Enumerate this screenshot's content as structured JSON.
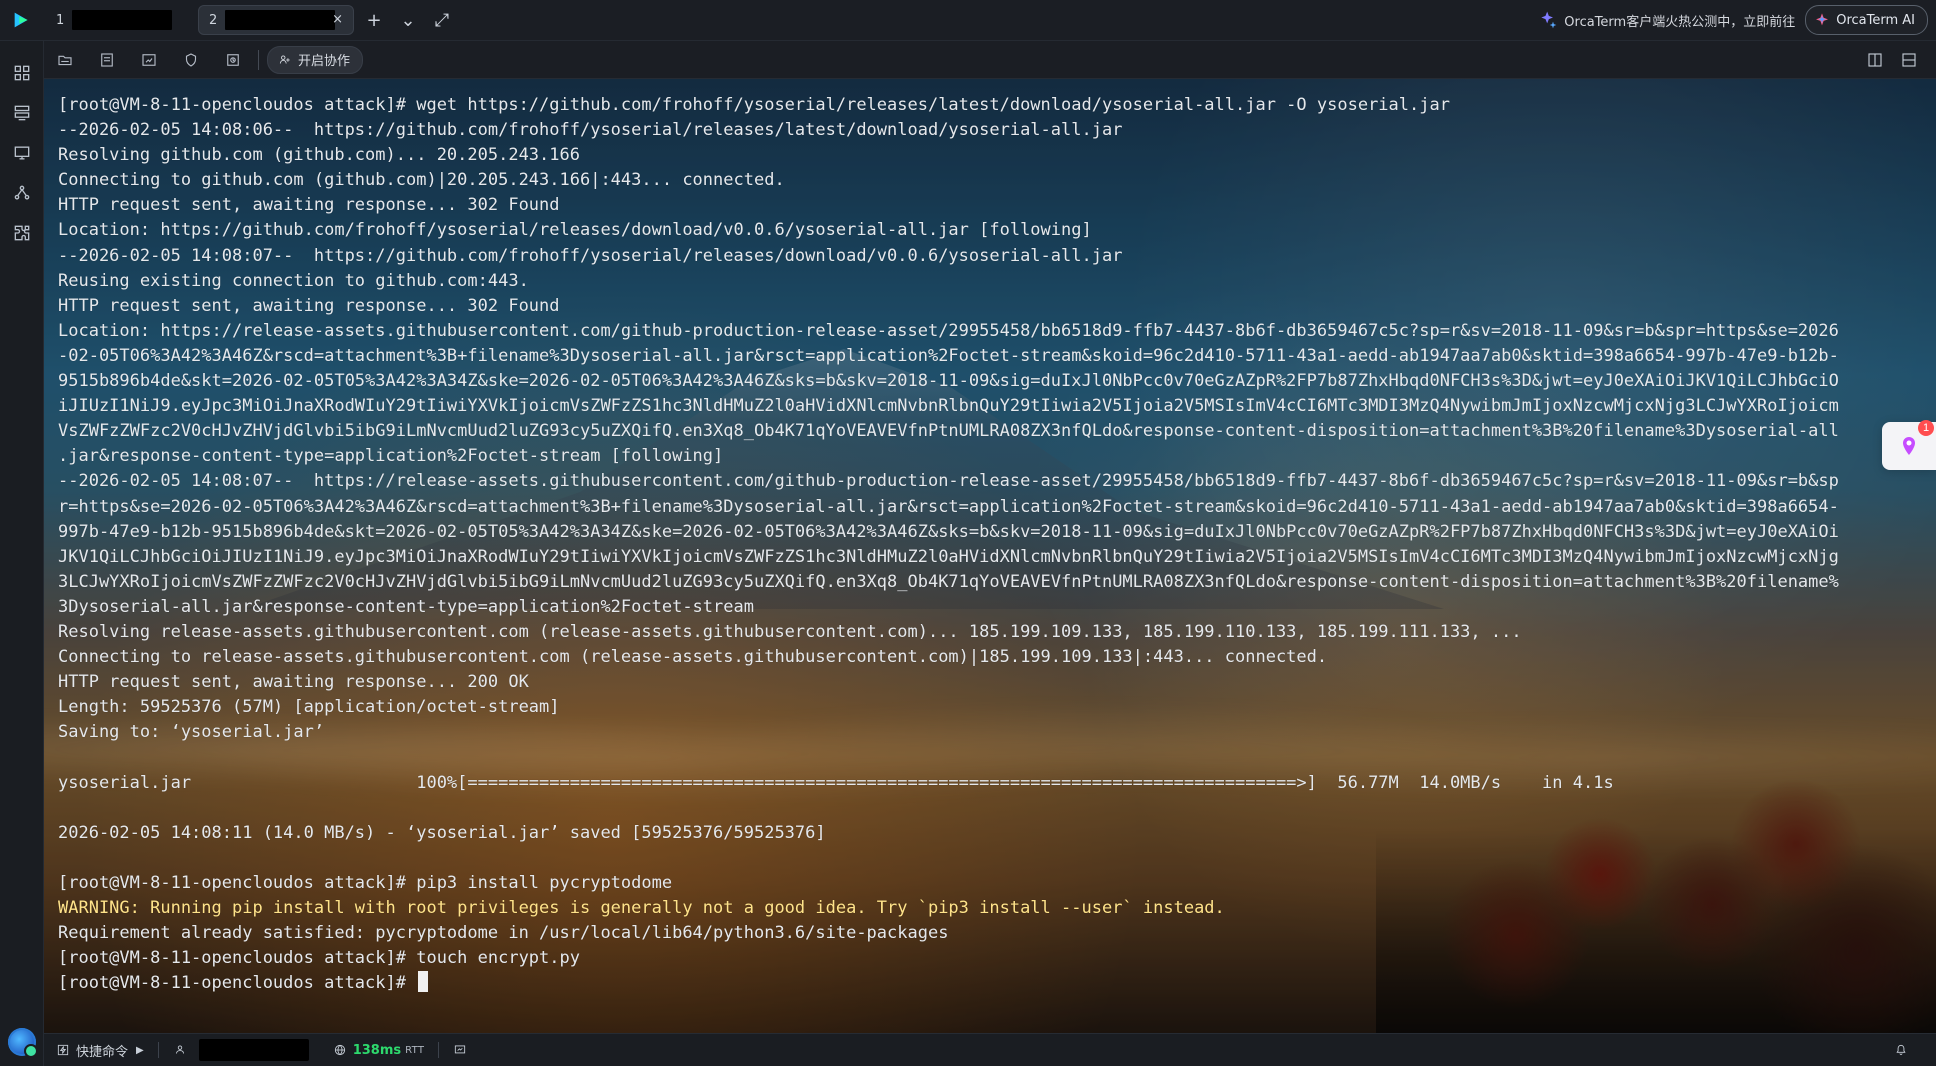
{
  "tabs": [
    {
      "index": "1"
    },
    {
      "index": "2",
      "close_symbol": "×"
    }
  ],
  "tab_actions": {
    "add_symbol": "+",
    "dropdown_symbol": "⌄",
    "expand_symbol": "⤢"
  },
  "promo": {
    "text": "OrcaTerm客户端火热公测中，立即前往",
    "ai_button_label": "OrcaTerm AI"
  },
  "toolbar": {
    "collab_label": "开启协作"
  },
  "terminal": {
    "lines": [
      {
        "text": "[root@VM-8-11-opencloudos attack]# wget https://github.com/frohoff/ysoserial/releases/latest/download/ysoserial-all.jar -O ysoserial.jar",
        "kind": "normal"
      },
      {
        "text": "--2026-02-05 14:08:06--  https://github.com/frohoff/ysoserial/releases/latest/download/ysoserial-all.jar",
        "kind": "normal"
      },
      {
        "text": "Resolving github.com (github.com)... 20.205.243.166",
        "kind": "normal"
      },
      {
        "text": "Connecting to github.com (github.com)|20.205.243.166|:443... connected.",
        "kind": "normal"
      },
      {
        "text": "HTTP request sent, awaiting response... 302 Found",
        "kind": "normal"
      },
      {
        "text": "Location: https://github.com/frohoff/ysoserial/releases/download/v0.0.6/ysoserial-all.jar [following]",
        "kind": "normal"
      },
      {
        "text": "--2026-02-05 14:08:07--  https://github.com/frohoff/ysoserial/releases/download/v0.0.6/ysoserial-all.jar",
        "kind": "normal"
      },
      {
        "text": "Reusing existing connection to github.com:443.",
        "kind": "normal"
      },
      {
        "text": "HTTP request sent, awaiting response... 302 Found",
        "kind": "normal"
      },
      {
        "text": "Location: https://release-assets.githubusercontent.com/github-production-release-asset/29955458/bb6518d9-ffb7-4437-8b6f-db3659467c5c?sp=r&sv=2018-11-09&sr=b&spr=https&se=2026",
        "kind": "normal"
      },
      {
        "text": "-02-05T06%3A42%3A46Z&rscd=attachment%3B+filename%3Dysoserial-all.jar&rsct=application%2Foctet-stream&skoid=96c2d410-5711-43a1-aedd-ab1947aa7ab0&sktid=398a6654-997b-47e9-b12b-",
        "kind": "normal"
      },
      {
        "text": "9515b896b4de&skt=2026-02-05T05%3A42%3A34Z&ske=2026-02-05T06%3A42%3A46Z&sks=b&skv=2018-11-09&sig=duIxJl0NbPcc0v70eGzAZpR%2FP7b87ZhxHbqd0NFCH3s%3D&jwt=eyJ0eXAiOiJKV1QiLCJhbGciO",
        "kind": "normal"
      },
      {
        "text": "iJIUzI1NiJ9.eyJpc3MiOiJnaXRodWIuY29tIiwiYXVkIjoicmVsZWFzZS1hc3NldHMuZ2l0aHVidXNlcmNvbnRlbnQuY29tIiwia2V5Ijoia2V5MSIsImV4cCI6MTc3MDI3MzQ4NywibmJmIjoxNzcwMjcxNjg3LCJwYXRoIjoicm",
        "kind": "normal"
      },
      {
        "text": "VsZWFzZWFzc2V0cHJvZHVjdGlvbi5ibG9iLmNvcmUud2luZG93cy5uZXQifQ.en3Xq8_Ob4K71qYoVEAVEVfnPtnUMLRA08ZX3nfQLdo&response-content-disposition=attachment%3B%20filename%3Dysoserial-all",
        "kind": "normal"
      },
      {
        "text": ".jar&response-content-type=application%2Foctet-stream [following]",
        "kind": "normal"
      },
      {
        "text": "--2026-02-05 14:08:07--  https://release-assets.githubusercontent.com/github-production-release-asset/29955458/bb6518d9-ffb7-4437-8b6f-db3659467c5c?sp=r&sv=2018-11-09&sr=b&sp",
        "kind": "normal"
      },
      {
        "text": "r=https&se=2026-02-05T06%3A42%3A46Z&rscd=attachment%3B+filename%3Dysoserial-all.jar&rsct=application%2Foctet-stream&skoid=96c2d410-5711-43a1-aedd-ab1947aa7ab0&sktid=398a6654-",
        "kind": "normal"
      },
      {
        "text": "997b-47e9-b12b-9515b896b4de&skt=2026-02-05T05%3A42%3A34Z&ske=2026-02-05T06%3A42%3A46Z&sks=b&skv=2018-11-09&sig=duIxJl0NbPcc0v70eGzAZpR%2FP7b87ZhxHbqd0NFCH3s%3D&jwt=eyJ0eXAiOi",
        "kind": "normal"
      },
      {
        "text": "JKV1QiLCJhbGciOiJIUzI1NiJ9.eyJpc3MiOiJnaXRodWIuY29tIiwiYXVkIjoicmVsZWFzZS1hc3NldHMuZ2l0aHVidXNlcmNvbnRlbnQuY29tIiwia2V5Ijoia2V5MSIsImV4cCI6MTc3MDI3MzQ4NywibmJmIjoxNzcwMjcxNjg",
        "kind": "normal"
      },
      {
        "text": "3LCJwYXRoIjoicmVsZWFzZWFzc2V0cHJvZHVjdGlvbi5ibG9iLmNvcmUud2luZG93cy5uZXQifQ.en3Xq8_Ob4K71qYoVEAVEVfnPtnUMLRA08ZX3nfQLdo&response-content-disposition=attachment%3B%20filename%",
        "kind": "normal"
      },
      {
        "text": "3Dysoserial-all.jar&response-content-type=application%2Foctet-stream",
        "kind": "normal"
      },
      {
        "text": "Resolving release-assets.githubusercontent.com (release-assets.githubusercontent.com)... 185.199.109.133, 185.199.110.133, 185.199.111.133, ...",
        "kind": "normal"
      },
      {
        "text": "Connecting to release-assets.githubusercontent.com (release-assets.githubusercontent.com)|185.199.109.133|:443... connected.",
        "kind": "normal"
      },
      {
        "text": "HTTP request sent, awaiting response... 200 OK",
        "kind": "normal"
      },
      {
        "text": "Length: 59525376 (57M) [application/octet-stream]",
        "kind": "normal"
      },
      {
        "text": "Saving to: ‘ysoserial.jar’",
        "kind": "normal"
      },
      {
        "text": "",
        "kind": "blank"
      },
      {
        "text": "ysoserial.jar                      100%[=================================================================================>]  56.77M  14.0MB/s    in 4.1s",
        "kind": "normal"
      },
      {
        "text": "",
        "kind": "blank"
      },
      {
        "text": "2026-02-05 14:08:11 (14.0 MB/s) - ‘ysoserial.jar’ saved [59525376/59525376]",
        "kind": "normal"
      },
      {
        "text": "",
        "kind": "blank"
      },
      {
        "text": "[root@VM-8-11-opencloudos attack]# pip3 install pycryptodome",
        "kind": "normal"
      },
      {
        "text": "WARNING: Running pip install with root privileges is generally not a good idea. Try `pip3 install --user` instead.",
        "kind": "warning"
      },
      {
        "text": "Requirement already satisfied: pycryptodome in /usr/local/lib64/python3.6/site-packages",
        "kind": "normal"
      },
      {
        "text": "[root@VM-8-11-opencloudos attack]# touch encrypt.py",
        "kind": "normal"
      },
      {
        "text": "[root@VM-8-11-opencloudos attack]# ",
        "kind": "prompt"
      }
    ]
  },
  "floating_assist": {
    "badge_count": "1"
  },
  "statusbar": {
    "quick_command_label": "快捷命令",
    "latency_value": "138ms",
    "latency_unit": "RTT"
  },
  "icons": {
    "app_logo": "logo-icon",
    "tab_add": "plus-icon",
    "tab_dropdown": "chevron-down-icon",
    "tab_expand": "expand-icon",
    "promo": "sparkles-icon",
    "ai": "ai-icon"
  },
  "colors": {
    "latency": "#2dd96d",
    "warning": "#ffe38a",
    "badge": "#ff4d4f"
  }
}
